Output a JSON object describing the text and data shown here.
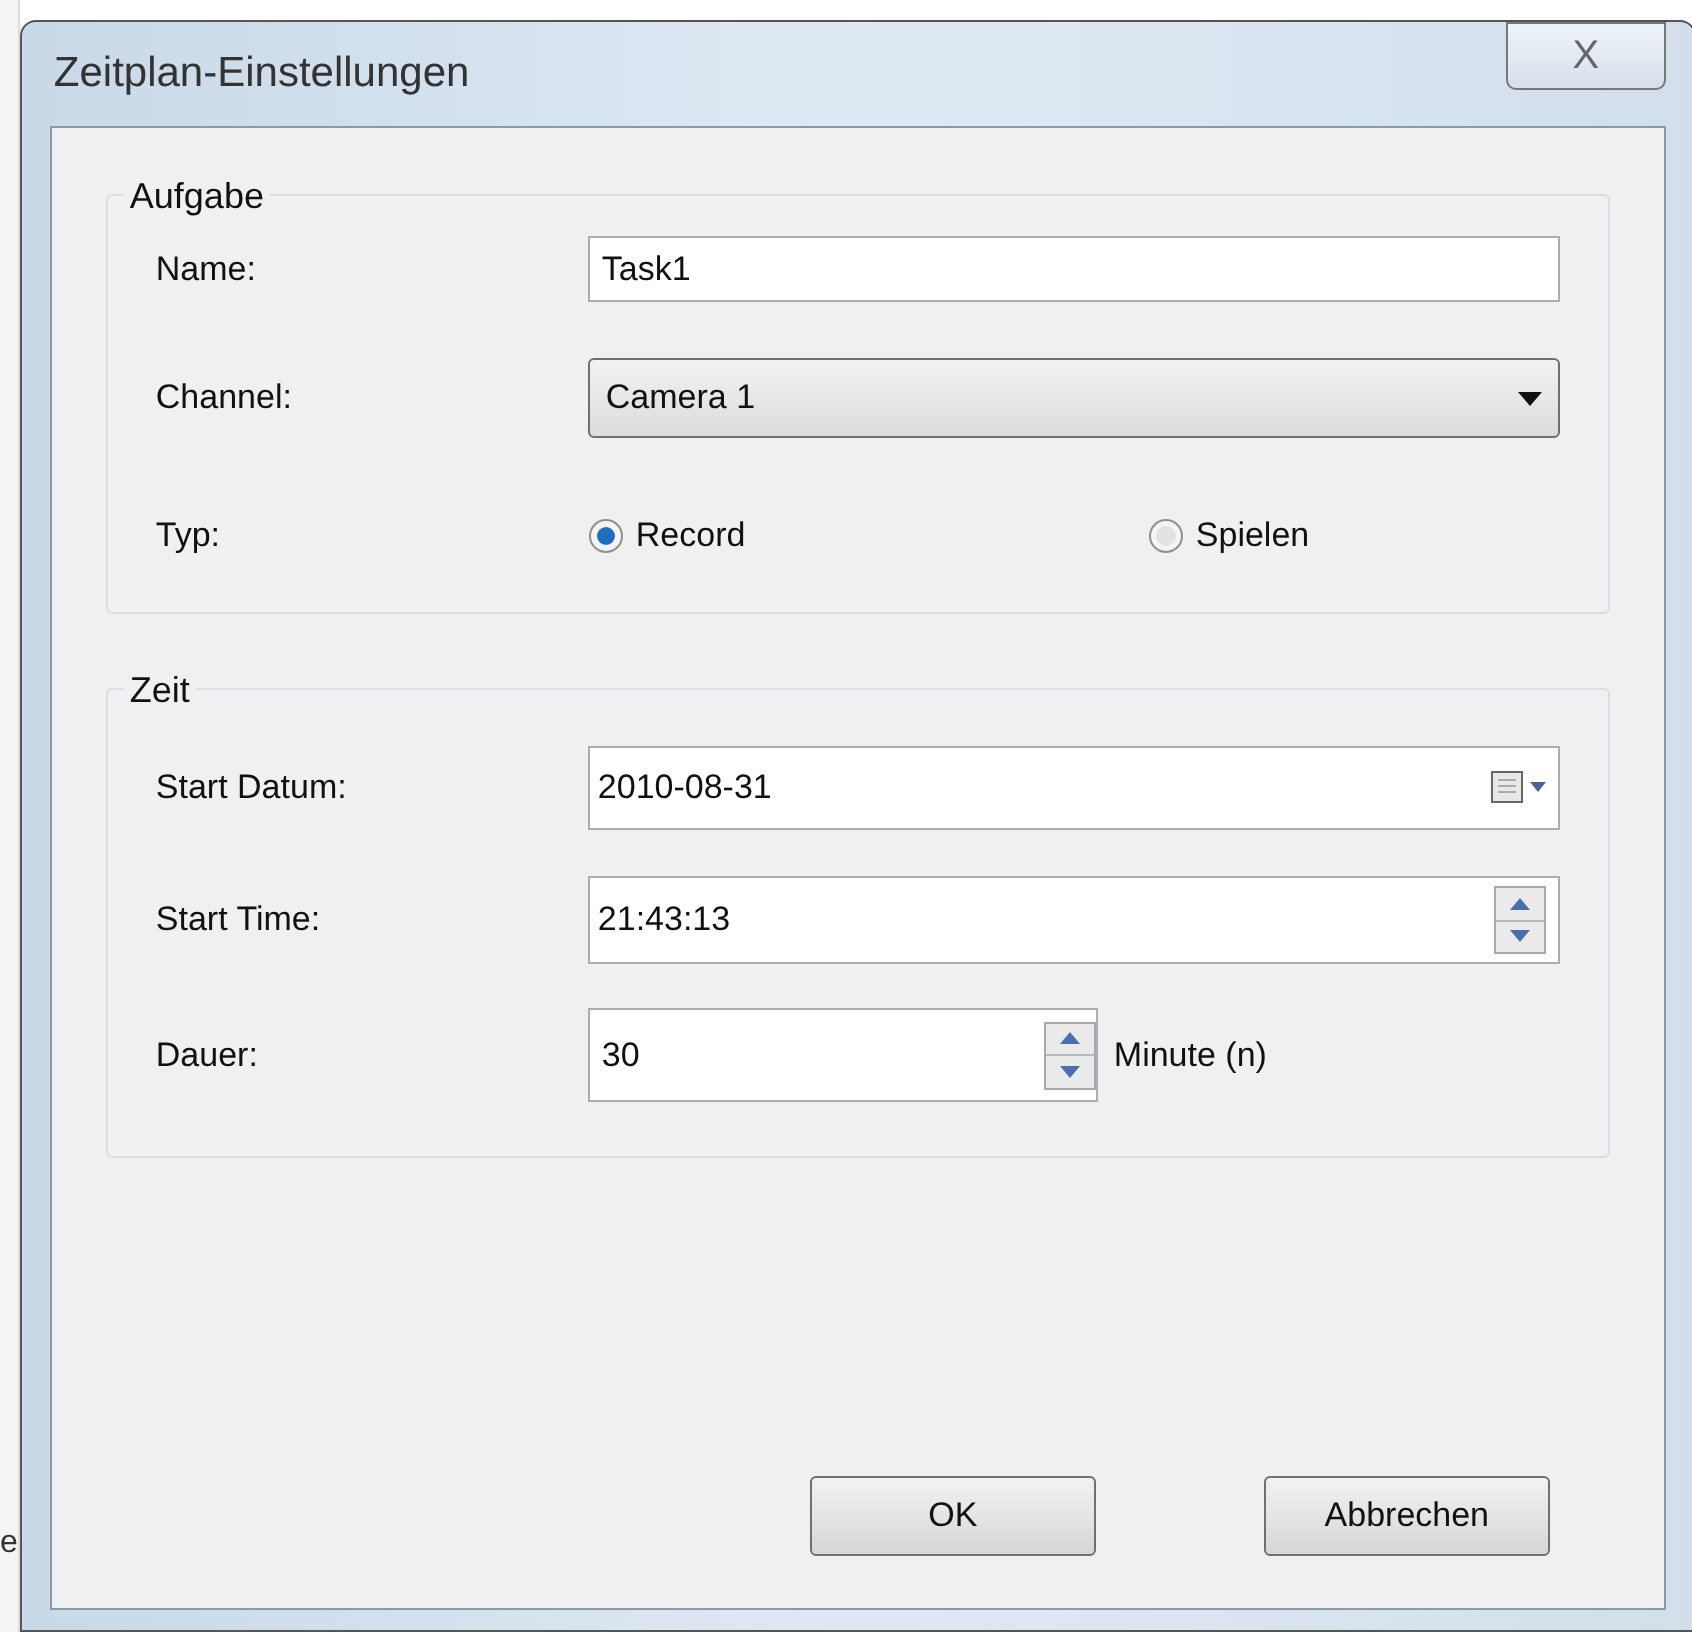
{
  "background_text": "e",
  "window": {
    "title": "Zeitplan-Einstellungen",
    "close": "X"
  },
  "aufgabe": {
    "legend": "Aufgabe",
    "name": {
      "label": "Name:",
      "value": "Task1"
    },
    "channel": {
      "label": "Channel:",
      "value": "Camera 1"
    },
    "typ": {
      "label": "Typ:",
      "options": [
        {
          "label": "Record",
          "selected": true
        },
        {
          "label": "Spielen",
          "selected": false
        }
      ]
    }
  },
  "zeit": {
    "legend": "Zeit",
    "start_datum": {
      "label": "Start Datum:",
      "value": "2010-08-31"
    },
    "start_time": {
      "label": "Start Time:",
      "value": "21:43:13"
    },
    "dauer": {
      "label": "Dauer:",
      "value": "30",
      "unit": "Minute (n)"
    }
  },
  "buttons": [
    "OK",
    "Abbrechen"
  ]
}
